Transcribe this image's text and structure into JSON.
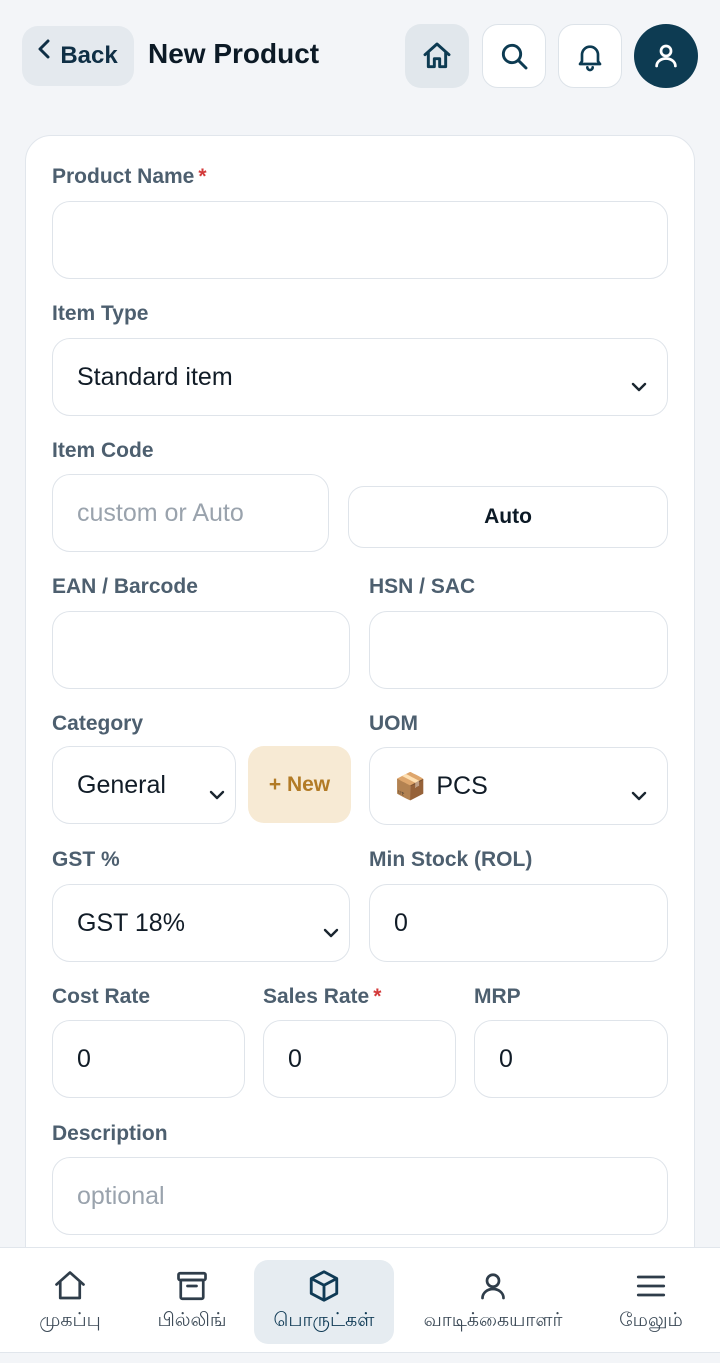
{
  "header": {
    "back_label": "Back",
    "title": "New Product"
  },
  "form": {
    "product_name": {
      "label": "Product Name",
      "required": "*",
      "value": ""
    },
    "item_type": {
      "label": "Item Type",
      "value": "Standard item"
    },
    "item_code": {
      "label": "Item Code",
      "placeholder": "custom or Auto",
      "auto_label": "Auto"
    },
    "ean": {
      "label": "EAN / Barcode",
      "value": ""
    },
    "hsn": {
      "label": "HSN / SAC",
      "value": ""
    },
    "category": {
      "label": "Category",
      "value": "General",
      "new_label": "+ New"
    },
    "uom": {
      "label": "UOM",
      "emoji": "📦",
      "value": "PCS"
    },
    "gst": {
      "label": "GST %",
      "value": "GST 18%"
    },
    "min_stock": {
      "label": "Min Stock (ROL)",
      "value": "0"
    },
    "cost_rate": {
      "label": "Cost Rate",
      "value": "0"
    },
    "sales_rate": {
      "label": "Sales Rate",
      "required": "*",
      "value": "0"
    },
    "mrp": {
      "label": "MRP",
      "value": "0"
    },
    "description": {
      "label": "Description",
      "placeholder": "optional"
    }
  },
  "nav": {
    "items": [
      {
        "label": "முகப்பு",
        "icon": "home-icon"
      },
      {
        "label": "பில்லிங்",
        "icon": "billing-icon"
      },
      {
        "label": "பொருட்கள்",
        "icon": "box-icon",
        "active": true
      },
      {
        "label": "வாடிக்கையாளர்",
        "icon": "user-icon"
      },
      {
        "label": "மேலும்",
        "icon": "menu-icon"
      }
    ]
  },
  "colors": {
    "primary": "#0d3b52",
    "accent_new": "#b27b26",
    "required": "#d33a3a"
  }
}
